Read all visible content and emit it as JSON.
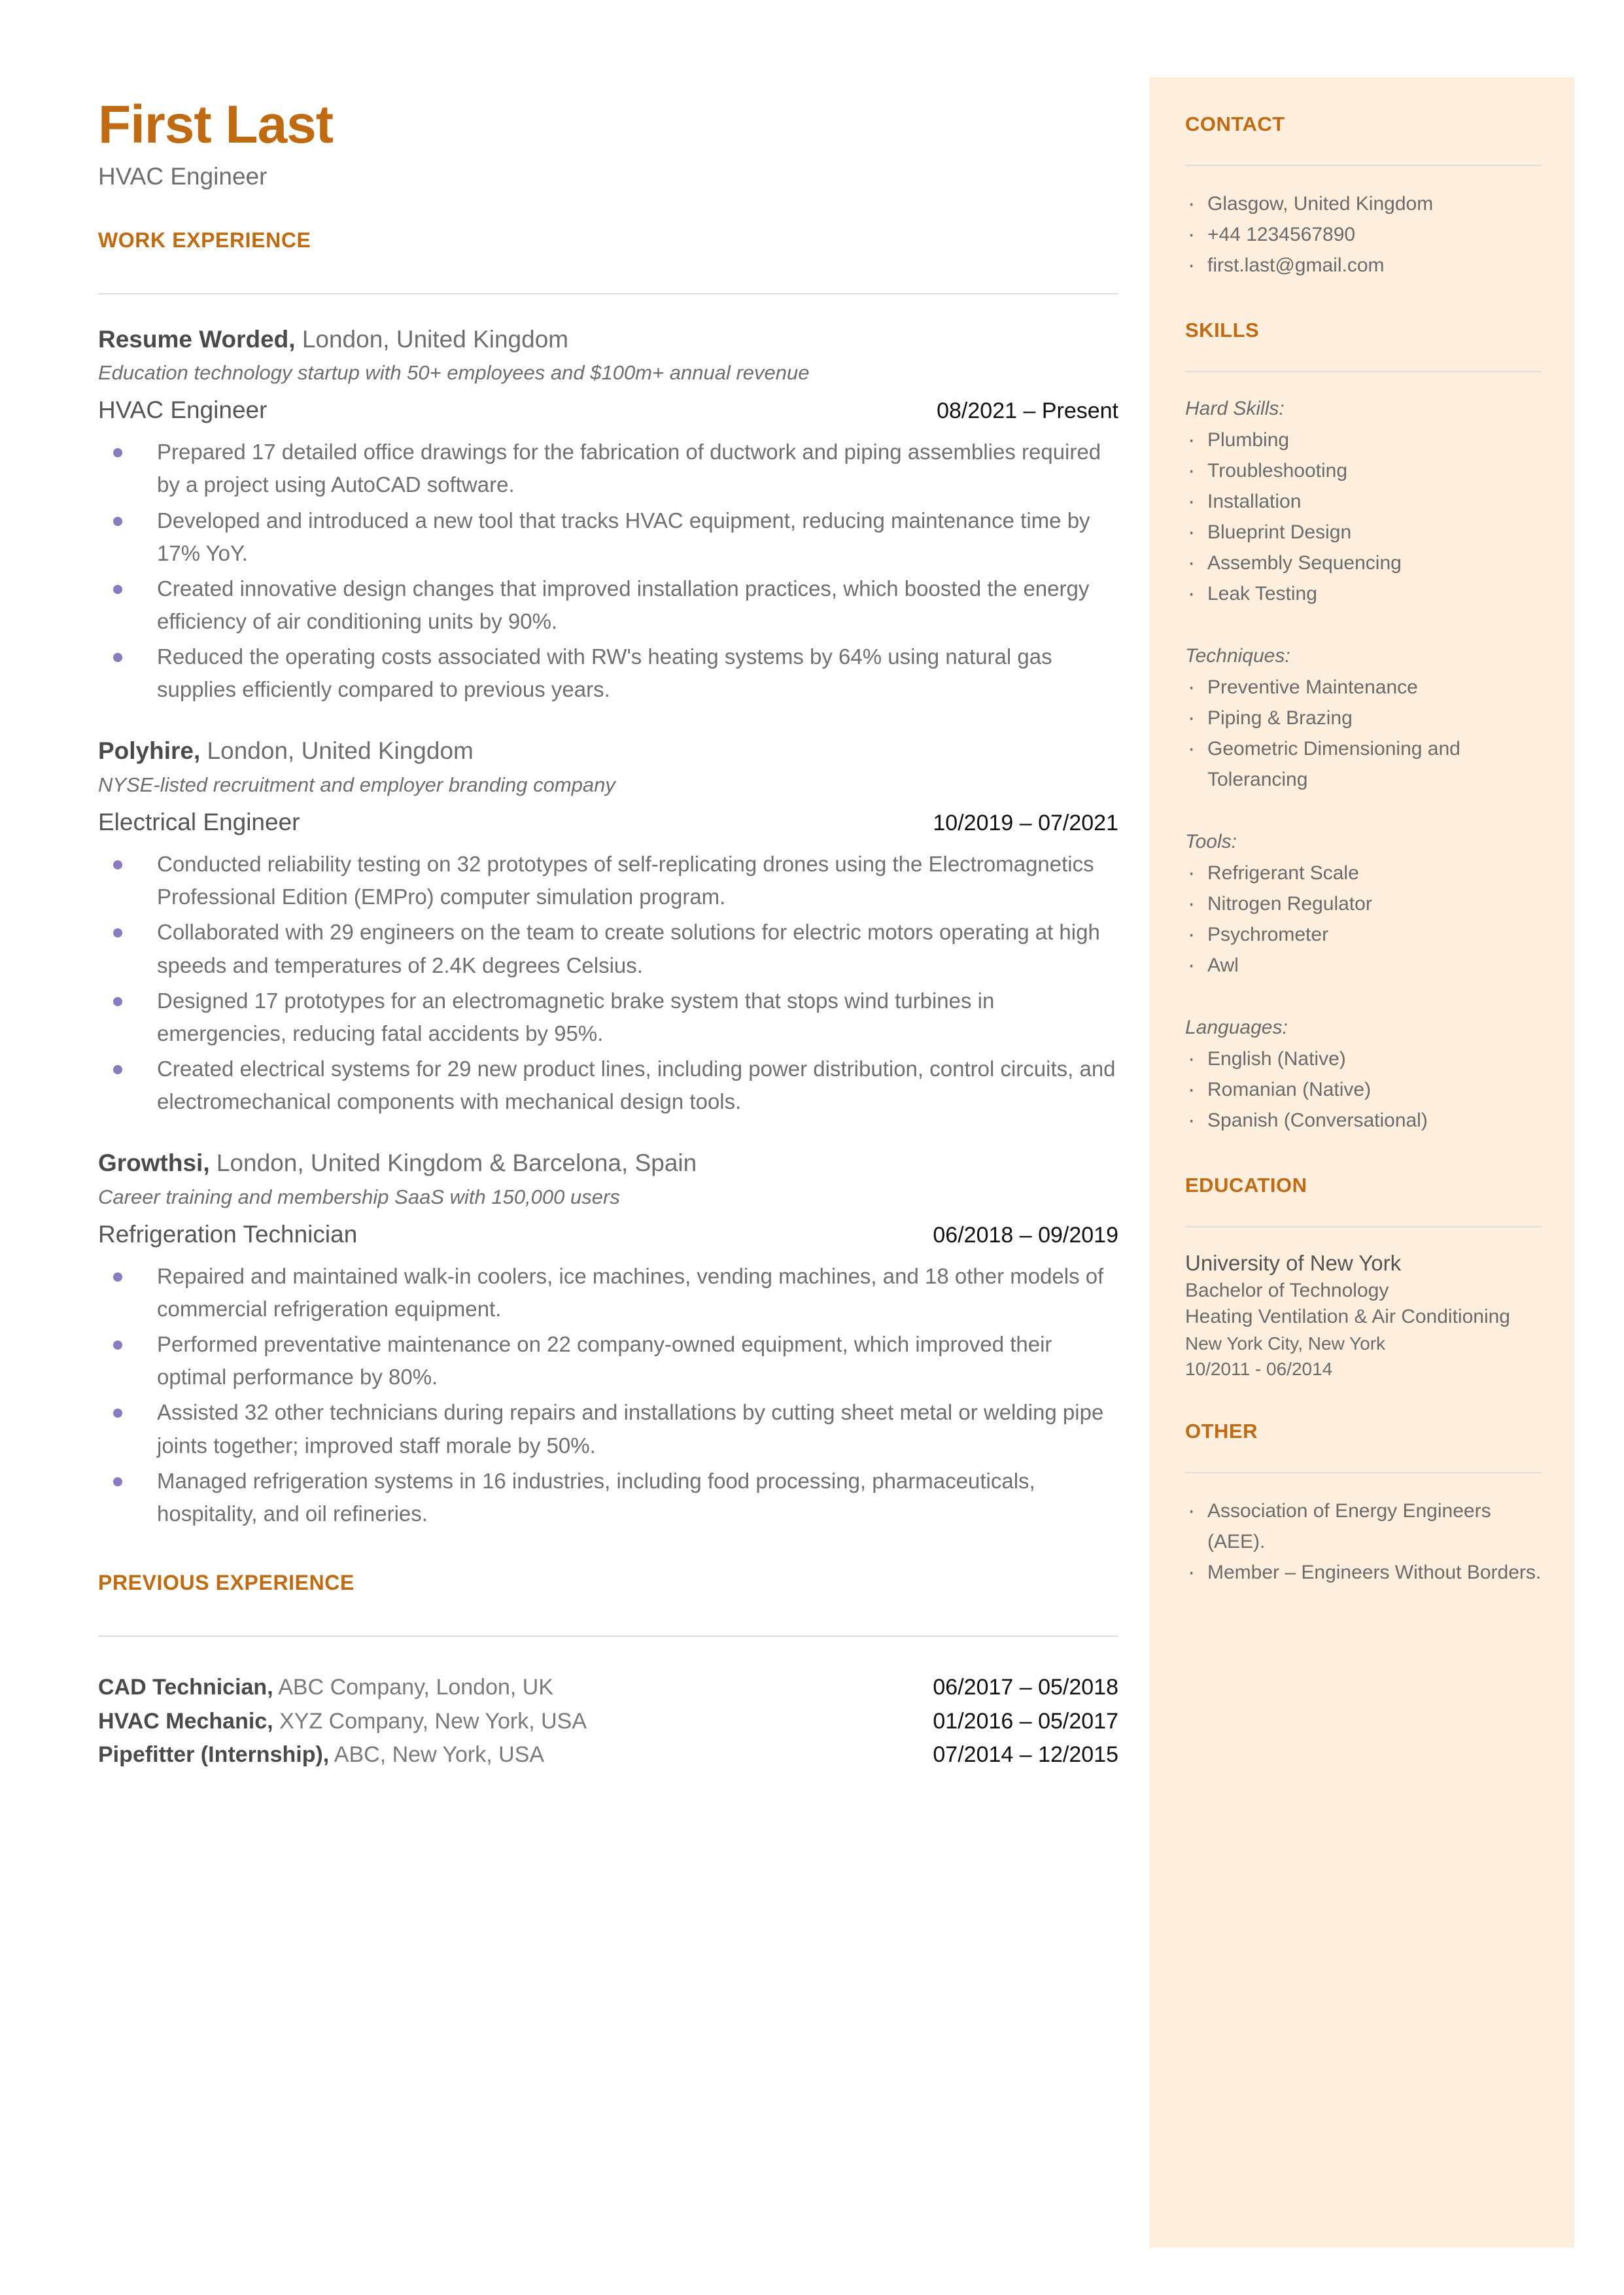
{
  "colors": {
    "accent": "#c06a11",
    "sidebar_bg": "#fdeedd",
    "bullet": "#8a7bc0",
    "body_text": "#6e6e6e",
    "date_text": "#111111",
    "rule": "#dedede"
  },
  "header": {
    "name": "First Last",
    "role": "HVAC Engineer"
  },
  "main": {
    "work_experience_heading": "WORK EXPERIENCE",
    "previous_experience_heading": "PREVIOUS EXPERIENCE",
    "jobs": [
      {
        "company": "Resume Worded,",
        "location": " London, United Kingdom",
        "description": "Education technology startup with 50+ employees and $100m+ annual revenue",
        "title": "HVAC Engineer",
        "dates": "08/2021 – Present",
        "bullets": [
          "Prepared 17 detailed office drawings for the fabrication of ductwork and piping assemblies required by a project using AutoCAD software.",
          "Developed and introduced a new tool that tracks HVAC equipment, reducing maintenance time by 17% YoY.",
          "Created innovative design changes that improved installation practices, which boosted the energy efficiency of air conditioning units by 90%.",
          "Reduced the operating costs associated with RW's heating systems by 64% using natural gas supplies efficiently compared to previous years."
        ]
      },
      {
        "company": "Polyhire,",
        "location": " London, United Kingdom",
        "description": "NYSE-listed recruitment and employer branding company",
        "title": "Electrical Engineer",
        "dates": "10/2019 – 07/2021",
        "bullets": [
          "Conducted reliability testing on 32 prototypes of self-replicating drones using the Electromagnetics Professional Edition (EMPro) computer simulation program.",
          "Collaborated with 29 engineers on the team to create solutions for electric motors operating at high speeds and temperatures of 2.4K  degrees Celsius.",
          "Designed 17 prototypes for an electromagnetic brake system that stops wind turbines in emergencies, reducing fatal accidents by 95%.",
          "Created electrical systems for 29 new product lines, including power distribution, control circuits, and electromechanical components with mechanical design tools."
        ]
      },
      {
        "company": "Growthsi,",
        "location": " London, United Kingdom & Barcelona, Spain",
        "description": "Career training and membership SaaS with 150,000 users",
        "title": "Refrigeration Technician",
        "dates": "06/2018 – 09/2019",
        "bullets": [
          "Repaired and maintained walk-in coolers, ice machines, vending machines, and 18 other models of commercial refrigeration equipment.",
          "Performed preventative maintenance on 22 company-owned equipment, which improved their optimal performance by 80%.",
          "Assisted 32 other technicians during repairs and installations by cutting sheet metal or welding pipe joints together; improved staff morale by 50%.",
          "Managed refrigeration systems in 16 industries, including food processing, pharmaceuticals, hospitality, and oil refineries."
        ]
      }
    ],
    "previous_experience": [
      {
        "title": "CAD Technician,",
        "detail": " ABC Company, London, UK",
        "dates": "06/2017 – 05/2018"
      },
      {
        "title": "HVAC Mechanic,",
        "detail": " XYZ Company, New York, USA",
        "dates": "01/2016 – 05/2017"
      },
      {
        "title": "Pipefitter (Internship),",
        "detail": " ABC, New York, USA",
        "dates": "07/2014 – 12/2015"
      }
    ]
  },
  "sidebar": {
    "contact": {
      "heading": "CONTACT",
      "items": [
        "Glasgow, United Kingdom",
        "+44 1234567890",
        "first.last@gmail.com"
      ]
    },
    "skills": {
      "heading": "SKILLS",
      "groups": [
        {
          "label": "Hard Skills:",
          "items": [
            "Plumbing",
            "Troubleshooting",
            "Installation",
            "Blueprint Design",
            "Assembly Sequencing",
            "Leak Testing"
          ]
        },
        {
          "label": "Techniques:",
          "items": [
            "Preventive Maintenance",
            "Piping & Brazing",
            "Geometric Dimensioning and Tolerancing"
          ]
        },
        {
          "label": "Tools:",
          "items": [
            "Refrigerant Scale",
            "Nitrogen Regulator",
            "Psychrometer",
            "Awl"
          ]
        },
        {
          "label": "Languages:",
          "items": [
            "English (Native)",
            "Romanian (Native)",
            "Spanish (Conversational)"
          ]
        }
      ]
    },
    "education": {
      "heading": "EDUCATION",
      "school": "University of New York",
      "degree": "Bachelor of Technology",
      "field": "Heating Ventilation & Air Conditioning",
      "location": "New York City, New York",
      "dates": "10/2011 - 06/2014"
    },
    "other": {
      "heading": "OTHER",
      "items": [
        "Association of Energy Engineers (AEE).",
        "Member – Engineers Without Borders."
      ]
    }
  }
}
